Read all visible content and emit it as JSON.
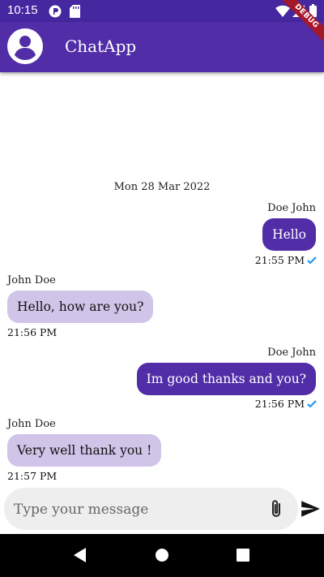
{
  "status": {
    "time": "10:15"
  },
  "debug_label": "DEBUG",
  "appbar": {
    "title": "ChatApp"
  },
  "date_separator": "Mon 28 Mar 2022",
  "messages": [
    {
      "sender": "Doe John",
      "text": "Hello",
      "time": "21:55 PM",
      "outgoing": true,
      "read": true
    },
    {
      "sender": "John Doe",
      "text": "Hello, how are you?",
      "time": "21:56 PM",
      "outgoing": false
    },
    {
      "sender": "Doe John",
      "text": "Im good thanks and you?",
      "time": "21:56 PM",
      "outgoing": true,
      "read": true
    },
    {
      "sender": "John Doe",
      "text": "Very well thank you !",
      "time": "21:57 PM",
      "outgoing": false
    }
  ],
  "input": {
    "placeholder": "Type your message"
  },
  "colors": {
    "status_bar": "#4527a0",
    "app_bar": "#512da8",
    "outgoing_bubble": "#512da8",
    "incoming_bubble": "#d1c4e9",
    "read_tick": "#2196f3"
  },
  "icons": [
    "sim-icon",
    "sd-card-icon",
    "wifi-icon",
    "signal-icon",
    "battery-icon",
    "account-circle-icon",
    "read-receipt-icon",
    "attach-icon",
    "send-icon",
    "back-icon",
    "home-icon",
    "recents-icon"
  ]
}
